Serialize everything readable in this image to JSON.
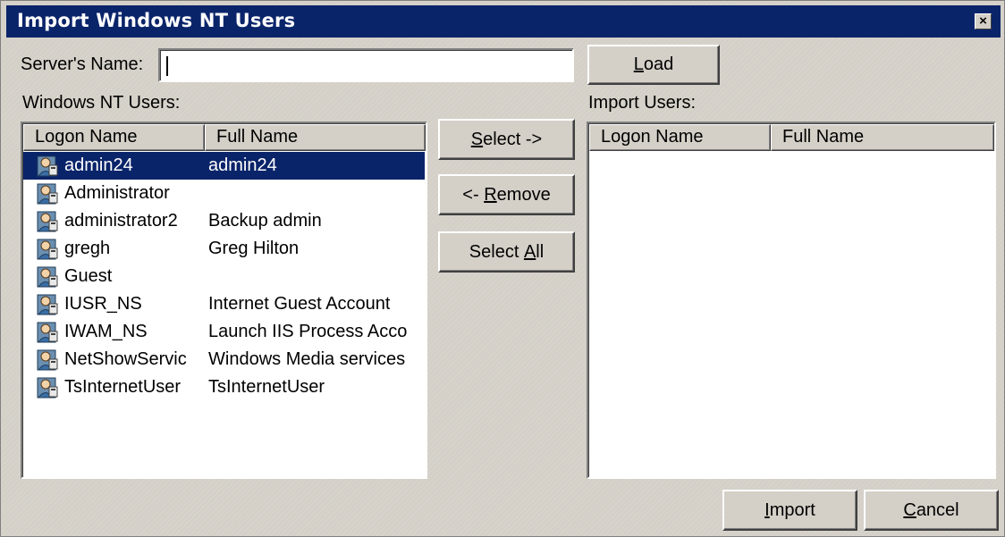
{
  "window": {
    "title": "Import Windows NT Users",
    "close_glyph": "×"
  },
  "server": {
    "label_prefix": "Server's Name:",
    "value": ""
  },
  "buttons": {
    "load_u": "L",
    "load_rest": "oad",
    "select_u": "S",
    "select_rest": "elect ->",
    "remove_pre": "<- ",
    "remove_u": "R",
    "remove_rest": "emove",
    "selectall_pre": "Select ",
    "selectall_u": "A",
    "selectall_rest": "ll",
    "import_u": "I",
    "import_rest": "mport",
    "cancel_u": "C",
    "cancel_rest": "ancel"
  },
  "nt_users": {
    "label": "Windows NT Users:",
    "columns": [
      "Logon Name",
      "Full Name"
    ],
    "rows": [
      {
        "logon": "admin24",
        "full": "admin24",
        "selected": true
      },
      {
        "logon": "Administrator",
        "full": ""
      },
      {
        "logon": "administrator2",
        "full": "Backup admin"
      },
      {
        "logon": "gregh",
        "full": "Greg Hilton"
      },
      {
        "logon": "Guest",
        "full": ""
      },
      {
        "logon": "IUSR_NS",
        "full": "Internet Guest Account"
      },
      {
        "logon": "IWAM_NS",
        "full": "Launch IIS Process Acco"
      },
      {
        "logon": "NetShowServic",
        "full": "Windows Media services"
      },
      {
        "logon": "TsInternetUser",
        "full": "TsInternetUser"
      }
    ]
  },
  "import_users": {
    "label": "Import Users:",
    "columns": [
      "Logon Name",
      "Full Name"
    ]
  },
  "icons": {
    "user": "user-icon",
    "close": "close-icon"
  },
  "colors": {
    "title_bar": "#0a246a",
    "face": "#d4d0c8",
    "selection": "#0a246a"
  }
}
